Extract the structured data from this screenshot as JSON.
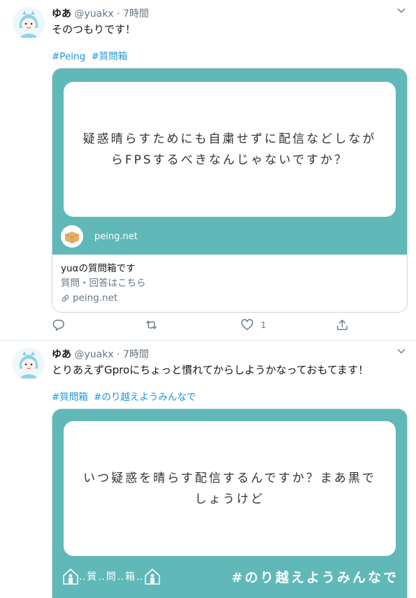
{
  "tweets": [
    {
      "display_name": "ゆあ",
      "handle": "@yuakx",
      "time": "· 7時間",
      "text": "そのつもりです！",
      "hashtags": [
        "#Peing",
        "#質問箱"
      ],
      "card": {
        "question": "疑惑晴らすためにも自粛せずに配信などしながらFPSするべきなんじゃないですか？",
        "brand": "peing.net",
        "title": "yuαの質問箱です",
        "description": "質問・回答はこちら",
        "link": "peing.net"
      },
      "actions": {
        "like_count": "1"
      }
    },
    {
      "display_name": "ゆあ",
      "handle": "@yuakx",
      "time": "· 7時間",
      "text": "とりあえずGproにちょっと慣れてからしようかなっておもてます！",
      "hashtags": [
        "#質問箱",
        "#のり越えようみんなで"
      ],
      "card": {
        "question": "いつ疑惑を晴らす配信するんですか？まあ黒でしょうけど",
        "footer_label": "‥質‥問‥箱‥",
        "footer_hashtag": "#のり越えようみんなで"
      }
    }
  ],
  "colors": {
    "card_teal": "#60b8b9",
    "link_blue": "#1b95e0",
    "muted": "#657786"
  },
  "icons": [
    "avatar",
    "chevron-down-icon",
    "reply-icon",
    "retweet-icon",
    "like-icon",
    "share-icon",
    "link-icon",
    "box-logo",
    "person-picto-icon"
  ]
}
